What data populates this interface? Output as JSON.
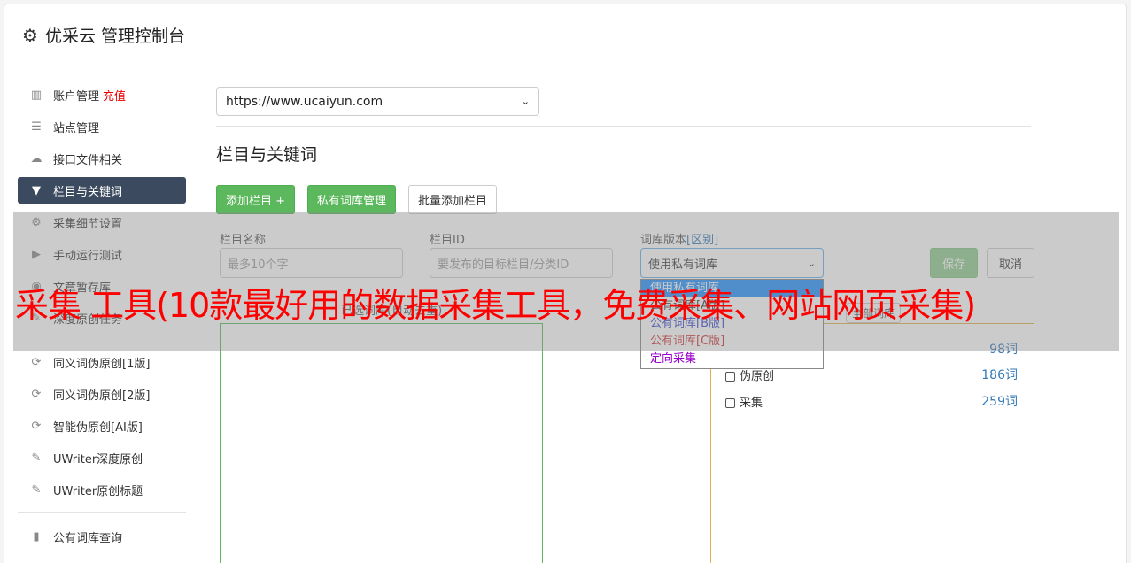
{
  "header": {
    "title": "优采云 管理控制台",
    "icon": "gear-icon"
  },
  "sidebar": {
    "items": [
      {
        "label": "账户管理",
        "tag": "充值",
        "icon": "bar-chart-icon"
      },
      {
        "label": "站点管理",
        "icon": "server-icon"
      },
      {
        "label": "接口文件相关",
        "icon": "cloud-upload-icon"
      },
      {
        "label": "栏目与关键词",
        "icon": "filter-icon",
        "active": true
      },
      {
        "label": "采集细节设置",
        "icon": "gears-icon"
      },
      {
        "label": "手动运行测试",
        "icon": "play-circle-icon"
      },
      {
        "label": "文章暂存库",
        "icon": "database-icon"
      },
      {
        "label": "深度原创任务",
        "icon": "edit-icon"
      },
      {
        "label": "同义词伪原创[1版]",
        "icon": "refresh-icon"
      },
      {
        "label": "同义词伪原创[2版]",
        "icon": "refresh-icon"
      },
      {
        "label": "智能伪原创[AI版]",
        "icon": "refresh-icon"
      },
      {
        "label": "UWriter深度原创",
        "icon": "edit-icon"
      },
      {
        "label": "UWriter原创标题",
        "icon": "edit-icon"
      },
      {
        "label": "公有词库查询",
        "icon": "book-icon"
      }
    ]
  },
  "main": {
    "site_select": "https://www.ucaiyun.com",
    "section_title": "栏目与关键词",
    "buttons": {
      "add_column": "添加栏目 +",
      "private_lib": "私有词库管理",
      "batch_add": "批量添加栏目"
    },
    "form": {
      "name_label": "栏目名称",
      "name_placeholder": "最多10个字",
      "id_label": "栏目ID",
      "id_placeholder": "要发布的目标栏目/分类ID",
      "version_label": "词库版本",
      "version_link": "[区别]",
      "version_value": "使用私有词库",
      "save": "保存",
      "cancel": "取消"
    },
    "dropdown_options": [
      "使用私有词库",
      "公有词库[A版]",
      "公有词库[B版]",
      "公有词库[C版]",
      "定向采集"
    ],
    "dropdown_colors": [
      "#ffffff",
      "#333333",
      "#3344cc",
      "#cc3333",
      "#9900cc"
    ],
    "left_label": "已选词库(自动去重)",
    "right_label": "全部词库",
    "keywords": [
      {
        "label": "",
        "count": "98词"
      },
      {
        "label": "伪原创",
        "count": "186词"
      },
      {
        "label": "采集",
        "count": "259词"
      }
    ]
  },
  "overlay": {
    "text": "采集 工具(10款最好用的数据采集工具，免费采集、网站网页采集)"
  }
}
